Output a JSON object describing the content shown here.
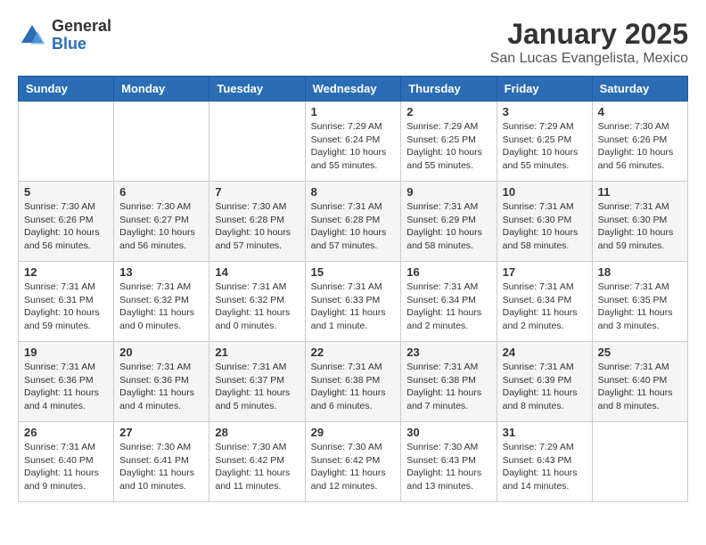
{
  "logo": {
    "general": "General",
    "blue": "Blue"
  },
  "title": "January 2025",
  "location": "San Lucas Evangelista, Mexico",
  "days_of_week": [
    "Sunday",
    "Monday",
    "Tuesday",
    "Wednesday",
    "Thursday",
    "Friday",
    "Saturday"
  ],
  "weeks": [
    [
      {
        "day": "",
        "info": ""
      },
      {
        "day": "",
        "info": ""
      },
      {
        "day": "",
        "info": ""
      },
      {
        "day": "1",
        "info": "Sunrise: 7:29 AM\nSunset: 6:24 PM\nDaylight: 10 hours and 55 minutes."
      },
      {
        "day": "2",
        "info": "Sunrise: 7:29 AM\nSunset: 6:25 PM\nDaylight: 10 hours and 55 minutes."
      },
      {
        "day": "3",
        "info": "Sunrise: 7:29 AM\nSunset: 6:25 PM\nDaylight: 10 hours and 55 minutes."
      },
      {
        "day": "4",
        "info": "Sunrise: 7:30 AM\nSunset: 6:26 PM\nDaylight: 10 hours and 56 minutes."
      }
    ],
    [
      {
        "day": "5",
        "info": "Sunrise: 7:30 AM\nSunset: 6:26 PM\nDaylight: 10 hours and 56 minutes."
      },
      {
        "day": "6",
        "info": "Sunrise: 7:30 AM\nSunset: 6:27 PM\nDaylight: 10 hours and 56 minutes."
      },
      {
        "day": "7",
        "info": "Sunrise: 7:30 AM\nSunset: 6:28 PM\nDaylight: 10 hours and 57 minutes."
      },
      {
        "day": "8",
        "info": "Sunrise: 7:31 AM\nSunset: 6:28 PM\nDaylight: 10 hours and 57 minutes."
      },
      {
        "day": "9",
        "info": "Sunrise: 7:31 AM\nSunset: 6:29 PM\nDaylight: 10 hours and 58 minutes."
      },
      {
        "day": "10",
        "info": "Sunrise: 7:31 AM\nSunset: 6:30 PM\nDaylight: 10 hours and 58 minutes."
      },
      {
        "day": "11",
        "info": "Sunrise: 7:31 AM\nSunset: 6:30 PM\nDaylight: 10 hours and 59 minutes."
      }
    ],
    [
      {
        "day": "12",
        "info": "Sunrise: 7:31 AM\nSunset: 6:31 PM\nDaylight: 10 hours and 59 minutes."
      },
      {
        "day": "13",
        "info": "Sunrise: 7:31 AM\nSunset: 6:32 PM\nDaylight: 11 hours and 0 minutes."
      },
      {
        "day": "14",
        "info": "Sunrise: 7:31 AM\nSunset: 6:32 PM\nDaylight: 11 hours and 0 minutes."
      },
      {
        "day": "15",
        "info": "Sunrise: 7:31 AM\nSunset: 6:33 PM\nDaylight: 11 hours and 1 minute."
      },
      {
        "day": "16",
        "info": "Sunrise: 7:31 AM\nSunset: 6:34 PM\nDaylight: 11 hours and 2 minutes."
      },
      {
        "day": "17",
        "info": "Sunrise: 7:31 AM\nSunset: 6:34 PM\nDaylight: 11 hours and 2 minutes."
      },
      {
        "day": "18",
        "info": "Sunrise: 7:31 AM\nSunset: 6:35 PM\nDaylight: 11 hours and 3 minutes."
      }
    ],
    [
      {
        "day": "19",
        "info": "Sunrise: 7:31 AM\nSunset: 6:36 PM\nDaylight: 11 hours and 4 minutes."
      },
      {
        "day": "20",
        "info": "Sunrise: 7:31 AM\nSunset: 6:36 PM\nDaylight: 11 hours and 4 minutes."
      },
      {
        "day": "21",
        "info": "Sunrise: 7:31 AM\nSunset: 6:37 PM\nDaylight: 11 hours and 5 minutes."
      },
      {
        "day": "22",
        "info": "Sunrise: 7:31 AM\nSunset: 6:38 PM\nDaylight: 11 hours and 6 minutes."
      },
      {
        "day": "23",
        "info": "Sunrise: 7:31 AM\nSunset: 6:38 PM\nDaylight: 11 hours and 7 minutes."
      },
      {
        "day": "24",
        "info": "Sunrise: 7:31 AM\nSunset: 6:39 PM\nDaylight: 11 hours and 8 minutes."
      },
      {
        "day": "25",
        "info": "Sunrise: 7:31 AM\nSunset: 6:40 PM\nDaylight: 11 hours and 8 minutes."
      }
    ],
    [
      {
        "day": "26",
        "info": "Sunrise: 7:31 AM\nSunset: 6:40 PM\nDaylight: 11 hours and 9 minutes."
      },
      {
        "day": "27",
        "info": "Sunrise: 7:30 AM\nSunset: 6:41 PM\nDaylight: 11 hours and 10 minutes."
      },
      {
        "day": "28",
        "info": "Sunrise: 7:30 AM\nSunset: 6:42 PM\nDaylight: 11 hours and 11 minutes."
      },
      {
        "day": "29",
        "info": "Sunrise: 7:30 AM\nSunset: 6:42 PM\nDaylight: 11 hours and 12 minutes."
      },
      {
        "day": "30",
        "info": "Sunrise: 7:30 AM\nSunset: 6:43 PM\nDaylight: 11 hours and 13 minutes."
      },
      {
        "day": "31",
        "info": "Sunrise: 7:29 AM\nSunset: 6:43 PM\nDaylight: 11 hours and 14 minutes."
      },
      {
        "day": "",
        "info": ""
      }
    ]
  ]
}
